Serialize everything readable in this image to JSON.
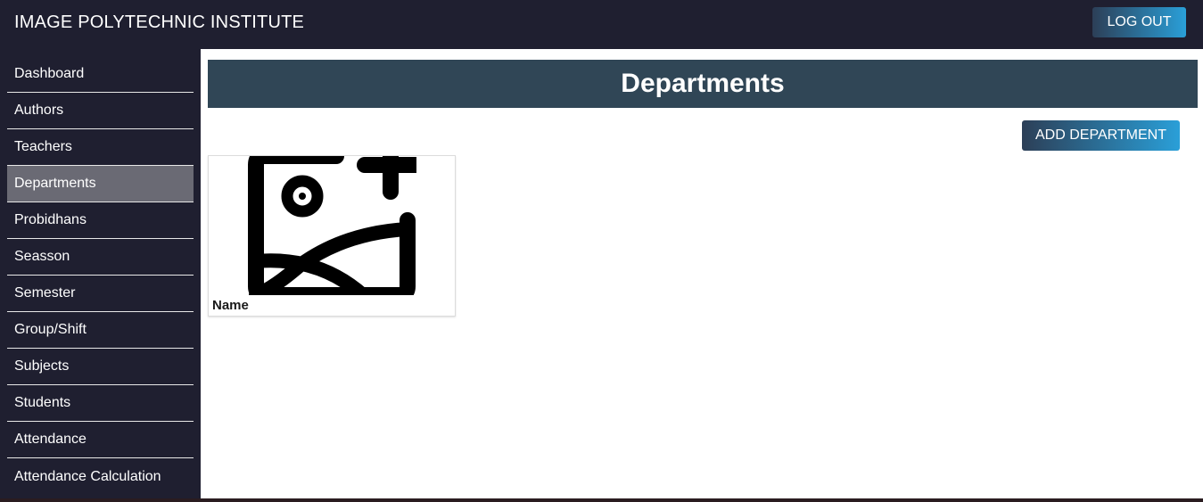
{
  "app": {
    "title": "IMAGE POLYTECHNIC INSTITUTE"
  },
  "header": {
    "logout_label": "LOG OUT"
  },
  "sidebar": {
    "items": [
      {
        "label": "Dashboard"
      },
      {
        "label": "Authors"
      },
      {
        "label": "Teachers"
      },
      {
        "label": "Departments",
        "active": true
      },
      {
        "label": "Probidhans"
      },
      {
        "label": "Seasson"
      },
      {
        "label": "Semester"
      },
      {
        "label": "Group/Shift"
      },
      {
        "label": "Subjects"
      },
      {
        "label": "Students"
      },
      {
        "label": "Attendance"
      },
      {
        "label": "Attendance Calculation"
      }
    ]
  },
  "main": {
    "title": "Departments",
    "add_label": "ADD DEPARTMENT",
    "cards": [
      {
        "name": "Name",
        "icon": "add-image-placeholder-icon"
      }
    ]
  },
  "colors": {
    "topbar_bg": "#1f1f30",
    "page_header_bg": "#304656",
    "button_gradient_start": "#2c3f57",
    "button_gradient_end": "#2a9fd8",
    "active_nav_bg": "#6a6a74"
  }
}
